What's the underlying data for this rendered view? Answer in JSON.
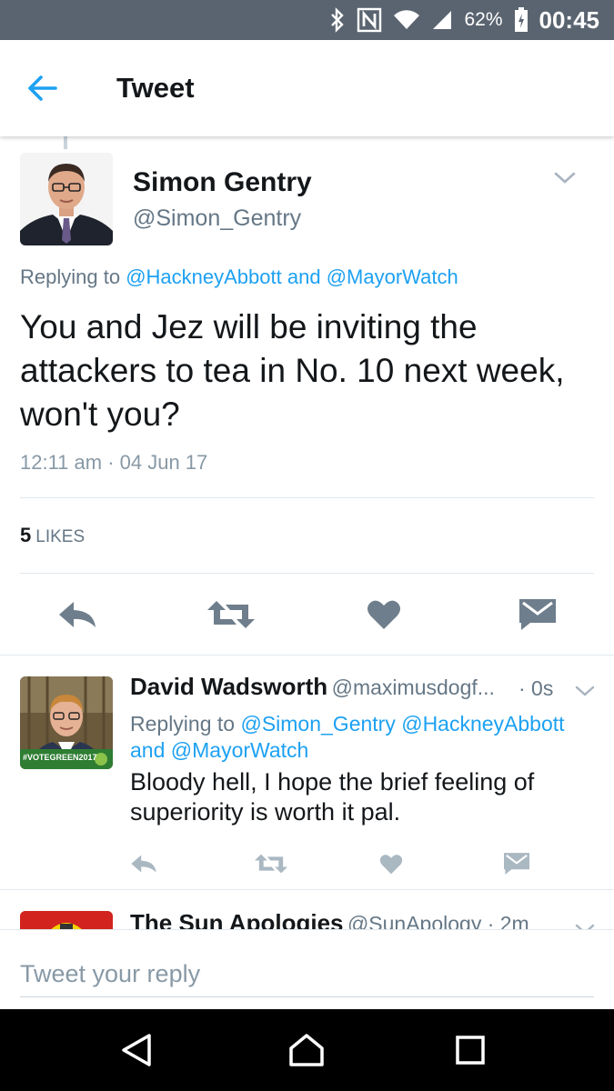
{
  "status_bar": {
    "battery_percent": "62%",
    "time": "00:45",
    "icons": [
      "bluetooth-icon",
      "nfc-icon",
      "wifi-icon",
      "signal-icon",
      "battery-icon"
    ]
  },
  "app_bar": {
    "title": "Tweet",
    "back_icon": "back-arrow-icon"
  },
  "main_tweet": {
    "author_name": "Simon Gentry",
    "author_handle": "@Simon_Gentry",
    "replying_prefix": "Replying to",
    "replying_to_1": "@HackneyAbbott",
    "replying_and": "and",
    "replying_to_2": "@MayorWatch",
    "text": "You and Jez will be inviting the attackers to tea in No. 10 next week, won't you?",
    "timestamp": "12:11 am · 04 Jun 17",
    "likes_count": "5",
    "likes_label": "LIKES"
  },
  "reply_tweet": {
    "author_name": "David Wadsworth",
    "author_handle": "@maximusdogf...",
    "time": "· 0s",
    "replying_prefix": "Replying to",
    "replying_to_1": "@Simon_Gentry",
    "replying_to_2": "@HackneyAbbott",
    "replying_and": "and",
    "replying_to_3": "@MayorWatch",
    "text": "Bloody hell, I hope the brief feeling of superiority is worth it pal.",
    "avatar_badge": "#VOTEGREEN2017"
  },
  "next_tweet": {
    "author_name": "The Sun Apologies",
    "author_handle": "@SunApology · 2m"
  },
  "composer": {
    "placeholder": "Tweet your reply"
  },
  "colors": {
    "accent": "#1da1f2",
    "secondary_text": "#657786",
    "action_icon": "#6f7e8c",
    "status_bar": "#5a6470"
  }
}
